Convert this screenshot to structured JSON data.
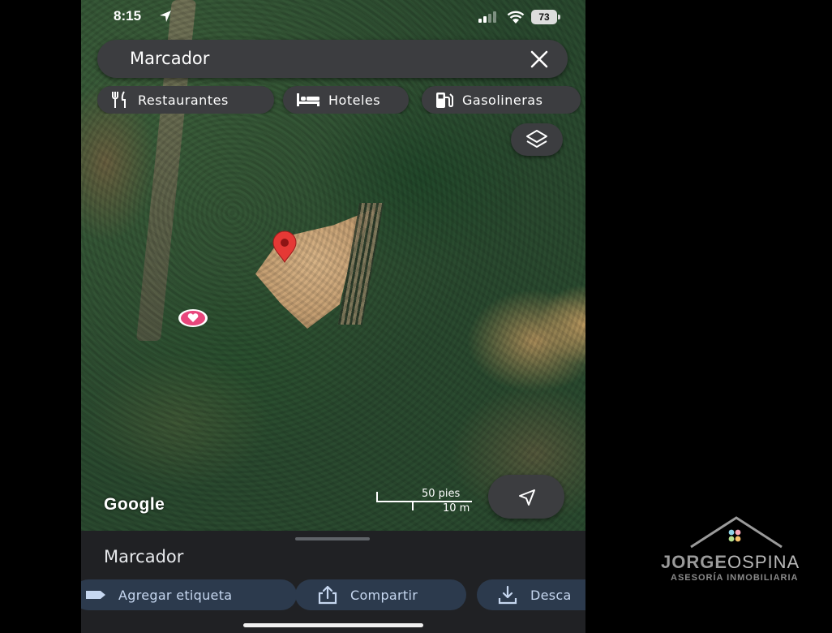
{
  "status_bar": {
    "time": "8:15",
    "battery": "73"
  },
  "search": {
    "query": "Marcador",
    "clear_icon": "close-icon"
  },
  "chips": [
    {
      "label": "Restaurantes",
      "icon": "restaurant-icon"
    },
    {
      "label": "Hoteles",
      "icon": "hotel-icon"
    },
    {
      "label": "Gasolineras",
      "icon": "gas-station-icon"
    }
  ],
  "map": {
    "attribution": "Google",
    "scale_imperial": "50 pies",
    "scale_metric": "10 m",
    "layers_icon": "layers-icon",
    "navigate_icon": "navigation-arrow-icon",
    "pin_color": "#e53935",
    "favorite_color": "#e8467c"
  },
  "sheet": {
    "title": "Marcador",
    "actions": [
      {
        "label": "Agregar etiqueta",
        "icon": "label-icon"
      },
      {
        "label": "Compartir",
        "icon": "share-icon"
      },
      {
        "label": "Desca",
        "icon": "download-icon"
      }
    ]
  },
  "watermark": {
    "name_bold": "JORGE",
    "name_light": "OSPINA",
    "subtitle": "ASESORÍA INMOBILIARIA"
  }
}
